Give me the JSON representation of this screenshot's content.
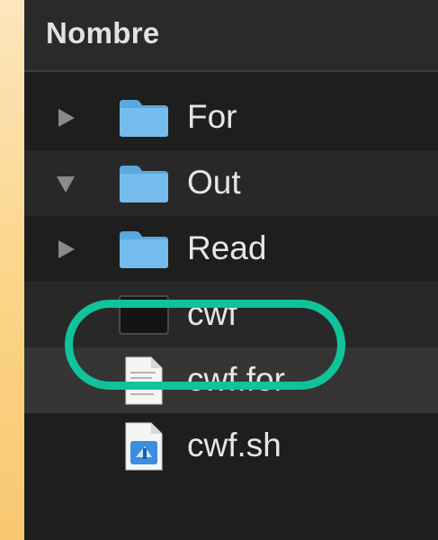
{
  "column_header": {
    "label": "Nombre"
  },
  "items": [
    {
      "name": "For",
      "kind": "folder",
      "disclosure": "collapsed"
    },
    {
      "name": "Out",
      "kind": "folder",
      "disclosure": "expanded"
    },
    {
      "name": "Read",
      "kind": "folder",
      "disclosure": "collapsed"
    },
    {
      "name": "cwf",
      "kind": "executable",
      "disclosure": "none"
    },
    {
      "name": "cwf.for",
      "kind": "text-document",
      "disclosure": "none"
    },
    {
      "name": "cwf.sh",
      "kind": "script-document",
      "disclosure": "none"
    }
  ],
  "annotation": {
    "shape": "rounded-rectangle",
    "color": "#10c39a"
  },
  "colors": {
    "folder": "#6fb9e8",
    "window_background": "#1e1e1e",
    "text": "#e6e6e6"
  }
}
